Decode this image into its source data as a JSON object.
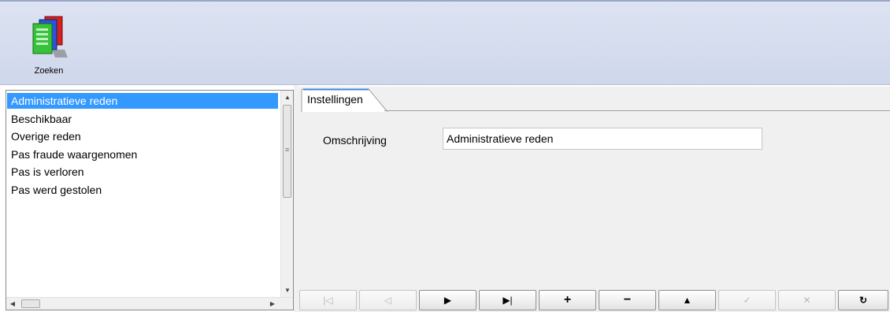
{
  "toolbar": {
    "search_button": {
      "label": "Zoeken",
      "icon": "books-search-icon"
    }
  },
  "list": {
    "items": [
      {
        "label": "Administratieve reden",
        "selected": true
      },
      {
        "label": "Beschikbaar",
        "selected": false
      },
      {
        "label": "Overige reden",
        "selected": false
      },
      {
        "label": "Pas fraude waargenomen",
        "selected": false
      },
      {
        "label": "Pas is verloren",
        "selected": false
      },
      {
        "label": "Pas werd gestolen",
        "selected": false
      }
    ]
  },
  "detail": {
    "tabs": [
      {
        "label": "Instellingen",
        "active": true
      }
    ],
    "fields": [
      {
        "label": "Omschrijving",
        "value": "Administratieve reden"
      }
    ]
  },
  "navigator": {
    "buttons": [
      {
        "name": "first",
        "glyph": "|◁",
        "enabled": false
      },
      {
        "name": "prior",
        "glyph": "◁",
        "enabled": false
      },
      {
        "name": "next",
        "glyph": "▶",
        "enabled": true
      },
      {
        "name": "last",
        "glyph": "▶|",
        "enabled": true
      },
      {
        "name": "insert",
        "glyph": "+",
        "enabled": true
      },
      {
        "name": "delete",
        "glyph": "−",
        "enabled": true
      },
      {
        "name": "edit",
        "glyph": "▲",
        "enabled": true
      },
      {
        "name": "post",
        "glyph": "✓",
        "enabled": false
      },
      {
        "name": "cancel",
        "glyph": "✕",
        "enabled": false
      },
      {
        "name": "refresh",
        "glyph": "↻",
        "enabled": true
      }
    ]
  },
  "colors": {
    "selection": "#3399ff",
    "toolbar_bg": "#d7ddef",
    "panel_bg": "#f0f0f0"
  }
}
